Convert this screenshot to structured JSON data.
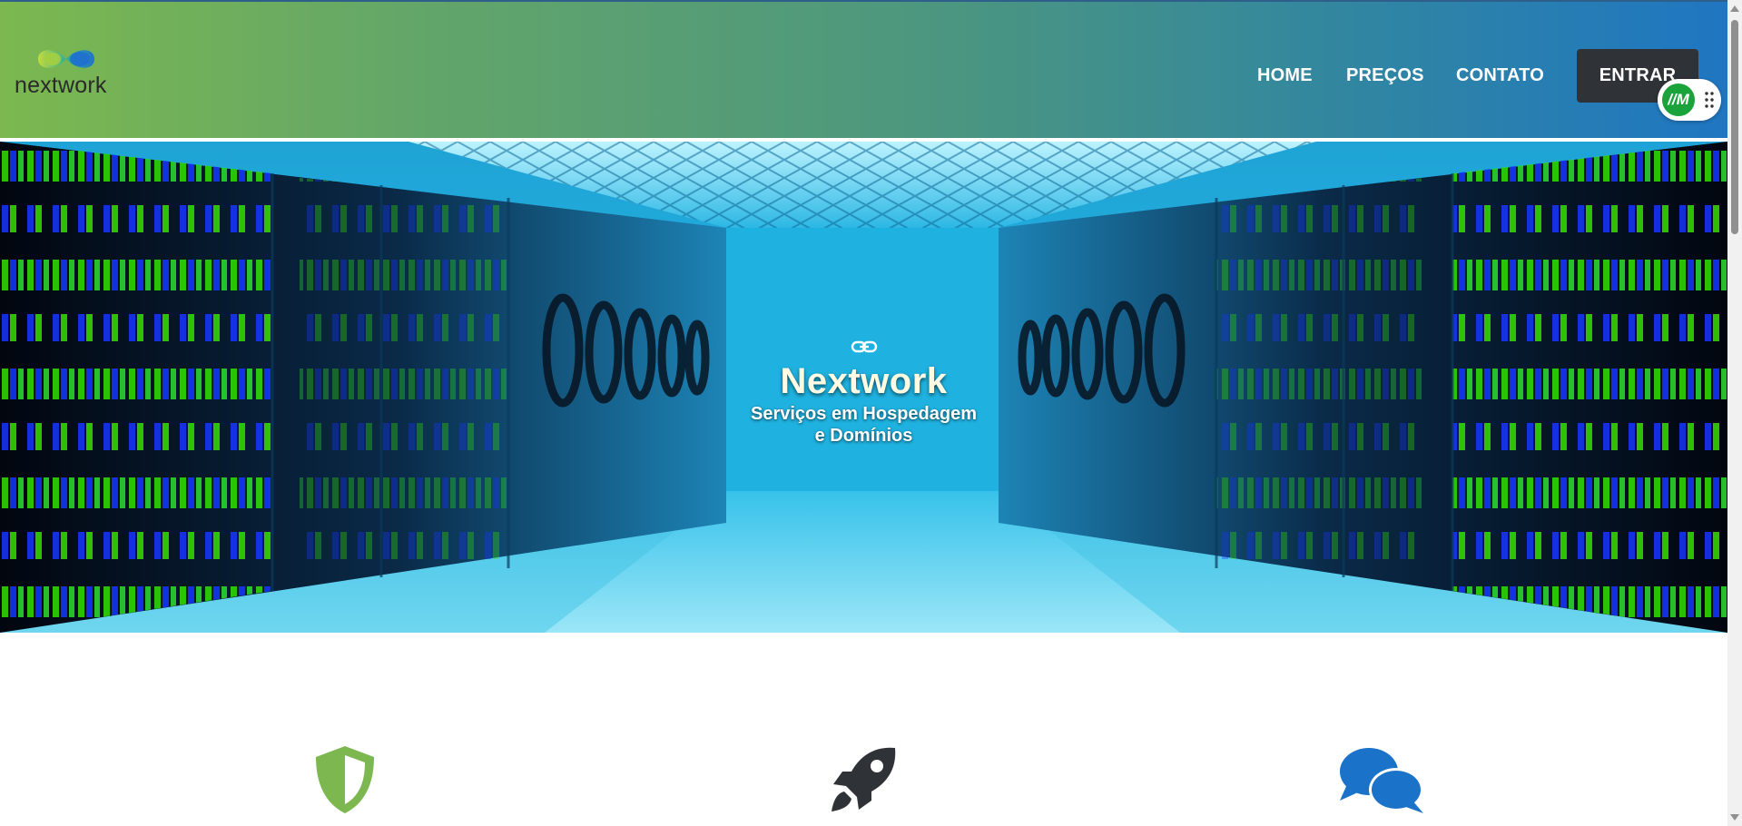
{
  "brand": {
    "name": "nextwork",
    "colors": {
      "green": "#7cb84f",
      "blue": "#1f76c2",
      "dark": "#2f3338"
    }
  },
  "nav": {
    "items": [
      {
        "label": "HOME"
      },
      {
        "label": "PREÇOS"
      },
      {
        "label": "CONTATO"
      }
    ],
    "login_label": "ENTRAR"
  },
  "extension_widget": {
    "label": "//M"
  },
  "hero": {
    "icon": "link-icon",
    "title": "Nextwork",
    "subtitle_line1": "Serviços em Hospedagem",
    "subtitle_line2": "e Domínios"
  },
  "features": [
    {
      "icon": "shield-icon",
      "color": "#7cb84f"
    },
    {
      "icon": "rocket-icon",
      "color": "#2f3338"
    },
    {
      "icon": "chat-bubbles-icon",
      "color": "#1a73c9"
    }
  ]
}
